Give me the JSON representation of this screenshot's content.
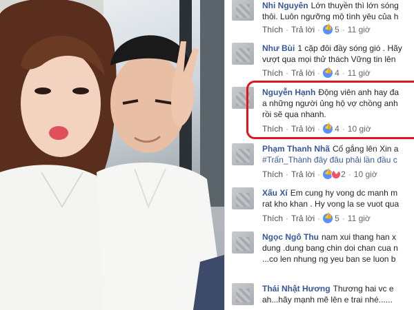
{
  "colors": {
    "name_link": "#365899",
    "text": "#1d2129",
    "meta": "#616770",
    "like_blue": "#5890ff",
    "love_red": "#f25268",
    "highlight_red": "#e0141e"
  },
  "photo": {
    "icon": "photo-of-couple"
  },
  "actions": {
    "like": "Thích",
    "reply": "Trả lời"
  },
  "comments": [
    {
      "name": "Nhi Nguyên",
      "lines": [
        "Lớn thuyền thì lớn sóng",
        "thôi. Luôn ngưỡng mộ tình yêu của h"
      ],
      "likes": "5",
      "time": "11 giờ",
      "reaction": "like"
    },
    {
      "name": "Như Bùi",
      "lines": [
        "1 cặp đôi đầy sóng gió . Hãy",
        "vượt qua mọi thử thách Vững tin lên"
      ],
      "likes": "4",
      "time": "11 giờ",
      "reaction": "like"
    },
    {
      "name": "Nguyễn Hạnh",
      "lines": [
        "Động viên anh hay đa",
        "a những người ủng hộ vợ chồng anh",
        "rồi sẽ qua nhanh."
      ],
      "likes": "4",
      "time": "10 giờ",
      "reaction": "like"
    },
    {
      "name": "Phạm Thanh Nhã",
      "lines": [
        "Cố gắng lên Xin a",
        "#Trấn_Thành đây đâu phải lần đầu c"
      ],
      "likes": "2",
      "time": "10 giờ",
      "reaction": "like-love"
    },
    {
      "name": "Xấu Xí",
      "lines": [
        "Em cung hy vong dc manh m",
        "rat kho khan . Hy vong la se vuot qua"
      ],
      "likes": "5",
      "time": "11 giờ",
      "reaction": "like"
    },
    {
      "name": "Ngọc Ngô Thu",
      "lines": [
        "nam xui thang han x",
        "dung .dung bang chin doi chan cua n",
        "...co len nhung ng yeu ban se luon b"
      ],
      "likes": "",
      "time": "",
      "reaction": "none"
    },
    {
      "name": "Thái Nhật Hương",
      "lines": [
        "Thương hai vc e",
        "ah...hãy mạnh mẽ lên e trai nhé......"
      ],
      "likes": "",
      "time": "",
      "reaction": "none"
    }
  ]
}
